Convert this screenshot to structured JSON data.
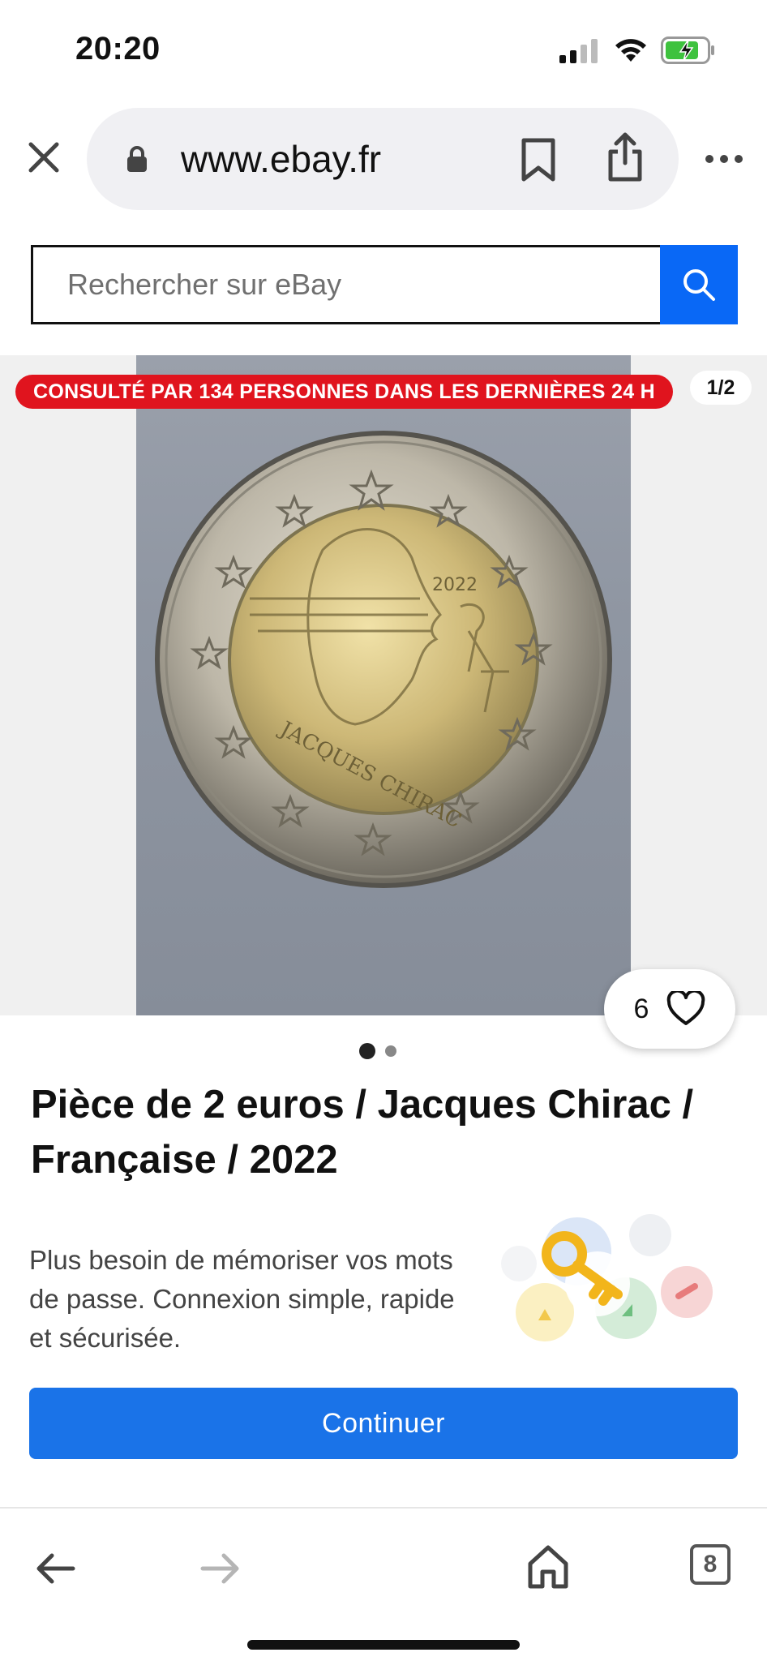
{
  "status_bar": {
    "time": "20:20"
  },
  "browser": {
    "url": "www.ebay.fr"
  },
  "search": {
    "placeholder": "Rechercher sur eBay"
  },
  "gallery": {
    "views_badge": "CONSULTÉ PAR 134 PERSONNES DANS LES DERNIÈRES 24 H",
    "counter": "1/2",
    "watch_count": "6",
    "dots": {
      "total": 2,
      "active": 1
    }
  },
  "item": {
    "title": "Pièce de 2 euros / Jacques Chirac / Française / 2022"
  },
  "passkey_sheet": {
    "text": "Plus besoin de mémoriser vos mots de passe. Connexion simple, rapide et sécurisée.",
    "continue_label": "Continuer"
  },
  "bottom_nav": {
    "tab_count": "8"
  },
  "colors": {
    "search_button": "#0968f6",
    "badge_red": "#e0141e",
    "continue_blue": "#1a73e8"
  },
  "icons": [
    "close-icon",
    "lock-icon",
    "bookmark-icon",
    "share-icon",
    "more-icon",
    "search-icon",
    "heart-icon",
    "back-arrow-icon",
    "forward-arrow-icon",
    "home-icon",
    "tabs-icon",
    "key-icon"
  ]
}
